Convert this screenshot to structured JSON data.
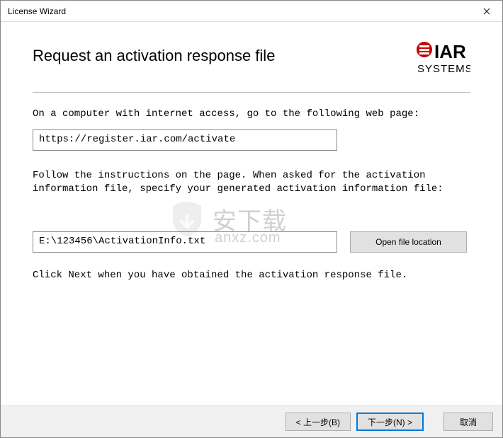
{
  "window": {
    "title": "License Wizard"
  },
  "header": {
    "page_title": "Request an activation response file",
    "brand_top": "IAR",
    "brand_bottom": "SYSTEMS"
  },
  "body": {
    "instruction1": "On a computer with internet access, go to the following web page:",
    "url": "https://register.iar.com/activate",
    "instruction2": "Follow the instructions on the page. When asked for the activation information file, specify your generated activation information file:",
    "file_path": "E:\\123456\\ActivationInfo.txt",
    "open_location_label": "Open file location",
    "instruction3": "Click Next when you have obtained the activation response file."
  },
  "footer": {
    "back_label": "< 上一步(B)",
    "next_label": "下一步(N) >",
    "cancel_label": "取消"
  },
  "watermark": {
    "text": "安下载",
    "sub": "anxz.com"
  }
}
